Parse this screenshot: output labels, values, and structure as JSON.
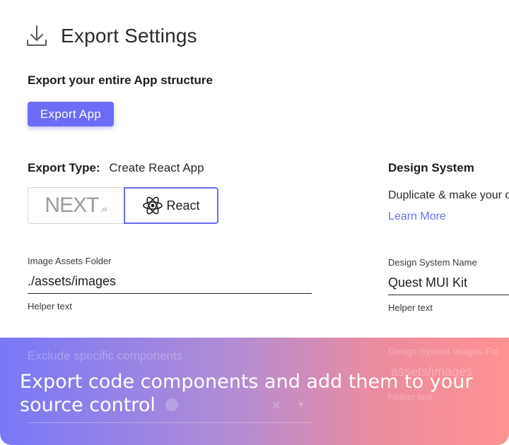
{
  "header": {
    "title": "Export Settings"
  },
  "export_app": {
    "heading": "Export your entire App structure",
    "button_label": "Export App"
  },
  "export_type": {
    "label": "Export Type:",
    "value": "Create React App",
    "options": [
      {
        "label": "NEXT",
        "sub": ".JS",
        "selected": false
      },
      {
        "label": "React",
        "selected": true
      }
    ]
  },
  "image_assets": {
    "label": "Image Assets Folder",
    "value": "./assets/images",
    "helper": "Helper text"
  },
  "design_system": {
    "title": "Design System",
    "description": "Duplicate & make your o",
    "link": "Learn More",
    "name_field": {
      "label": "Design System  Name",
      "value": "Quest MUI Kit",
      "helper": "Helper text"
    },
    "images_field": {
      "label": "Design System Images Fol",
      "value": "assets/images",
      "helper": "Helper text"
    }
  },
  "exclude": {
    "label": "Exclude specific components"
  },
  "overlay": {
    "caption": "Export code components and add them to your source control"
  },
  "colors": {
    "accent": "#6c6cf6",
    "text": "#1d1d20",
    "gradient_start": "#6e6ef6",
    "gradient_end": "#ff8c8c"
  }
}
